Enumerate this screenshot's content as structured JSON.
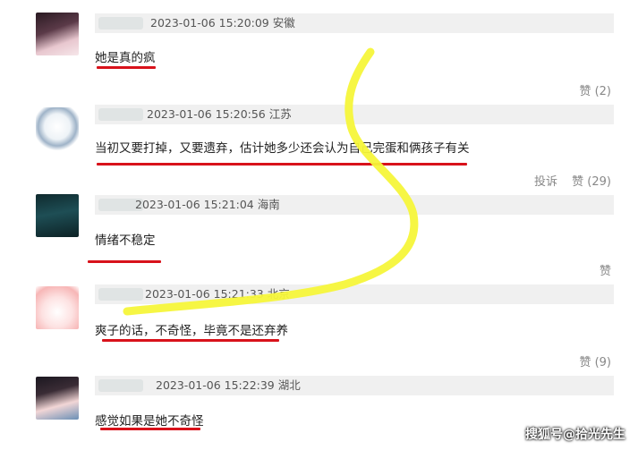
{
  "comments": [
    {
      "meta": "2023-01-06 15:20:09 安徽",
      "text": "她是真的疯",
      "likes_label": "赞 (2)",
      "report_label": ""
    },
    {
      "meta": "2023-01-06 15:20:56 江苏",
      "text": "当初又要打掉，又要遗弃，估计她多少还会认为自己完蛋和俩孩子有关",
      "likes_label": "赞 (29)",
      "report_label": "投诉"
    },
    {
      "meta": "2023-01-06 15:21:04 海南",
      "text": "情绪不稳定",
      "likes_label": "赞",
      "report_label": ""
    },
    {
      "meta": "2023-01-06 15:21:33 北京",
      "text": "爽子的话，不奇怪，毕竟不是还弃养",
      "likes_label": "赞 (9)",
      "report_label": ""
    },
    {
      "meta": "2023-01-06 15:22:39 湖北",
      "text": "感觉如果是她不奇怪",
      "likes_label": "",
      "report_label": ""
    }
  ],
  "watermark": "搜狐号@拾光先生",
  "colors": {
    "underline": "#d8121b",
    "highlight_stroke": "#f5f53a",
    "meta_bg": "#f0f0f0"
  }
}
